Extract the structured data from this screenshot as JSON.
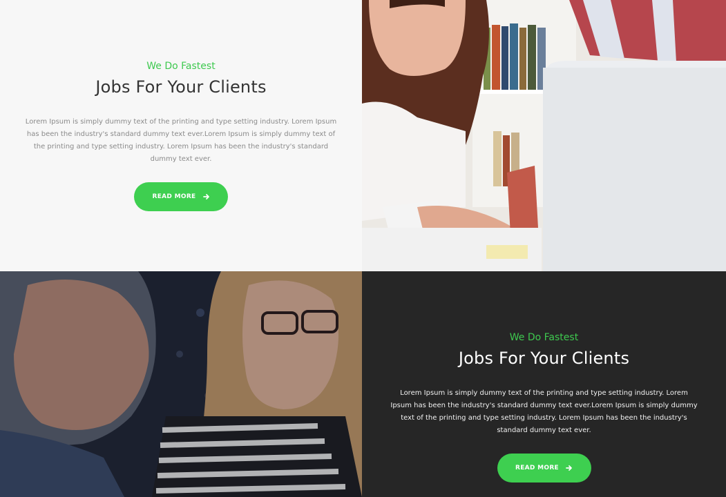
{
  "blocks": [
    {
      "kicker": "We Do Fastest",
      "title": "Jobs For Your Clients",
      "body": "Lorem Ipsum is simply dummy text of the printing and type setting industry. Lorem Ipsum has been the industry's standard dummy text ever.Lorem Ipsum is simply dummy text of the printing and type setting industry. Lorem Ipsum has been the industry's standard dummy text ever.",
      "button": "READ MORE"
    },
    {
      "kicker": "We Do Fastest",
      "title": "Jobs For Your Clients",
      "body": "Lorem Ipsum is simply dummy text of the printing and type setting industry. Lorem Ipsum has been the industry's standard dummy text ever.Lorem Ipsum is simply dummy text of the printing and type setting industry. Lorem Ipsum has been the industry's standard dummy text ever.",
      "button": "READ MORE"
    }
  ],
  "images": {
    "top_right": "photo-woman-with-laptop-and-phone",
    "bottom_left": "photo-man-and-woman-with-glasses"
  },
  "icons": {
    "button_arrow": "arrow-right-icon"
  },
  "colors": {
    "accent": "#3ecf50",
    "light_bg": "#f7f7f7",
    "dark_bg": "#262626",
    "title_dark": "#333333",
    "title_light": "#ffffff"
  }
}
